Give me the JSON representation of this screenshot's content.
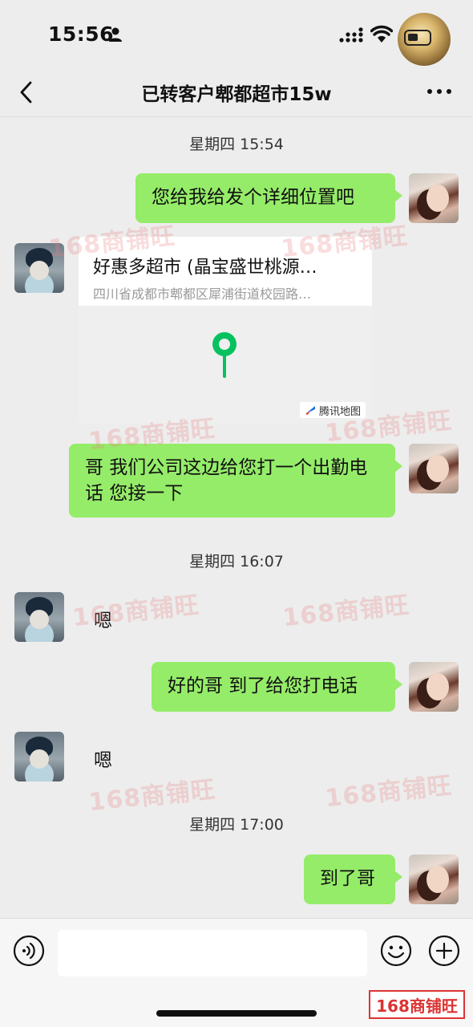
{
  "status_bar": {
    "time": "15:56"
  },
  "nav": {
    "title": "已转客户郫都超市15w"
  },
  "messages": {
    "ts1": "星期四 15:54",
    "m1": "您给我给发个详细位置吧",
    "location": {
      "name": "好惠多超市 (晶宝盛世桃源…",
      "address": "四川省成都市郫都区犀浦街道校园路…",
      "map_brand": "腾讯地图"
    },
    "m2": "哥 我们公司这边给您打一个出勤电话 您接一下",
    "ts2": "星期四 16:07",
    "m3": "嗯",
    "m4": "好的哥 到了给您打电话",
    "m5": "嗯",
    "ts3": "星期四 17:00",
    "m6": "到了哥"
  },
  "watermark": {
    "text": "168商铺旺"
  },
  "colors": {
    "bubble_green": "#95ec69",
    "background": "#ededed",
    "pin_green": "#07c160"
  }
}
